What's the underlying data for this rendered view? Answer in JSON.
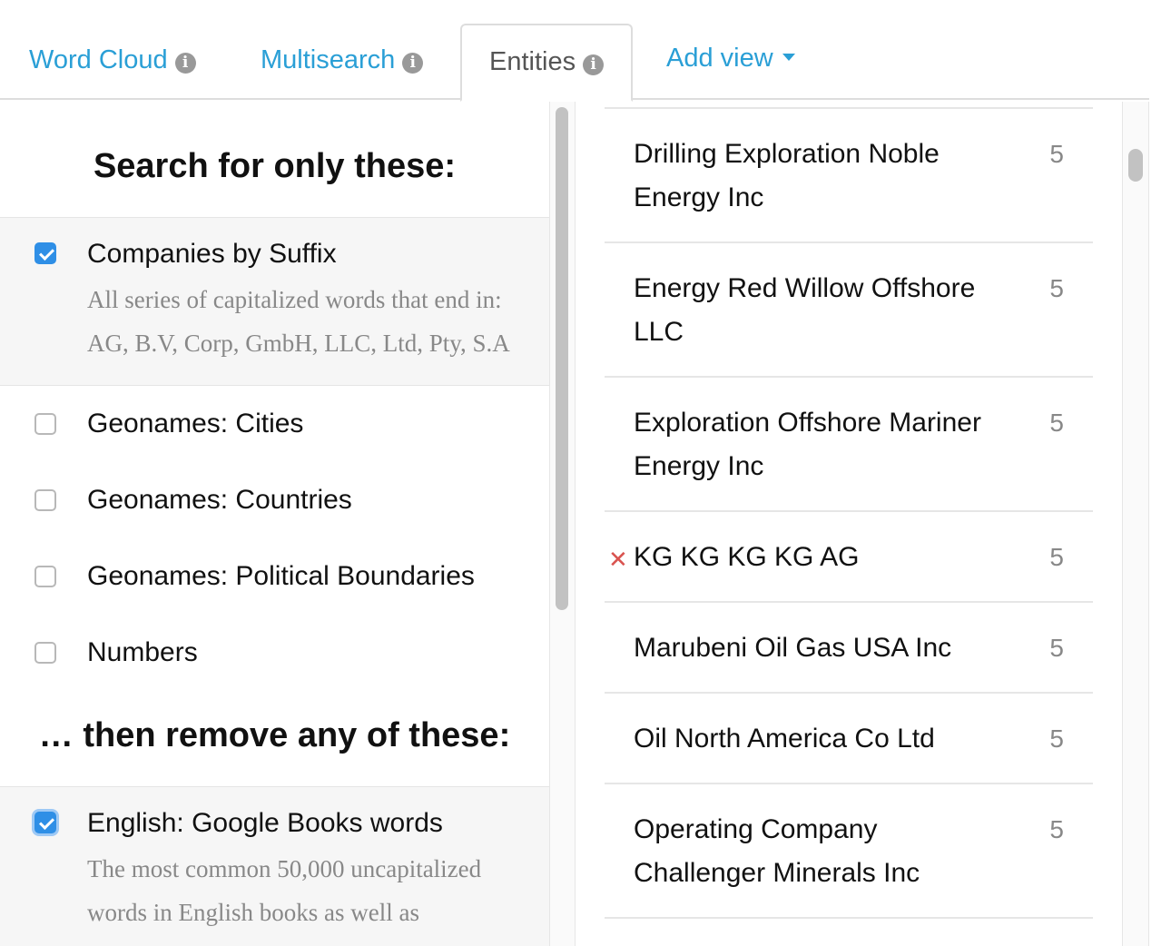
{
  "tabs": [
    {
      "label": "Word Cloud",
      "has_info": true,
      "active": false
    },
    {
      "label": "Multisearch",
      "has_info": true,
      "active": false
    },
    {
      "label": "Entities",
      "has_info": true,
      "active": true
    },
    {
      "label": "Add view",
      "has_dropdown": true,
      "active": false
    }
  ],
  "icons": {
    "info": "i",
    "remove": "✕"
  },
  "colors": {
    "link": "#2a9fd6",
    "checkbox_checked": "#2f8fe6",
    "remove": "#d9534f"
  },
  "left": {
    "include_title": "Search for only these:",
    "include_options": [
      {
        "label": "Companies by Suffix",
        "checked": true,
        "description": "All series of capitalized words that end in: AG, B.V, Corp, GmbH, LLC, Ltd, Pty, S.A"
      },
      {
        "label": "Geonames: Cities",
        "checked": false
      },
      {
        "label": "Geonames: Countries",
        "checked": false
      },
      {
        "label": "Geonames: Political Boundaries",
        "checked": false
      },
      {
        "label": "Numbers",
        "checked": false
      }
    ],
    "exclude_title": "… then remove any of these:",
    "exclude_options": [
      {
        "label": "English: Google Books words",
        "checked": true,
        "description": "The most common 50,000 uncapitalized words in English books as well as"
      }
    ]
  },
  "entities": [
    {
      "name": "Drilling Exploration Noble Energy Inc",
      "count": "5",
      "removed": false
    },
    {
      "name": "Energy Red Willow Offshore LLC",
      "count": "5",
      "removed": false
    },
    {
      "name": "Exploration Offshore Mariner Energy Inc",
      "count": "5",
      "removed": false
    },
    {
      "name": "KG KG KG KG AG",
      "count": "5",
      "removed": true
    },
    {
      "name": "Marubeni Oil Gas USA Inc",
      "count": "5",
      "removed": false
    },
    {
      "name": "Oil North America Co Ltd",
      "count": "5",
      "removed": false
    },
    {
      "name": "Operating Company Challenger Minerals Inc",
      "count": "5",
      "removed": false
    }
  ]
}
